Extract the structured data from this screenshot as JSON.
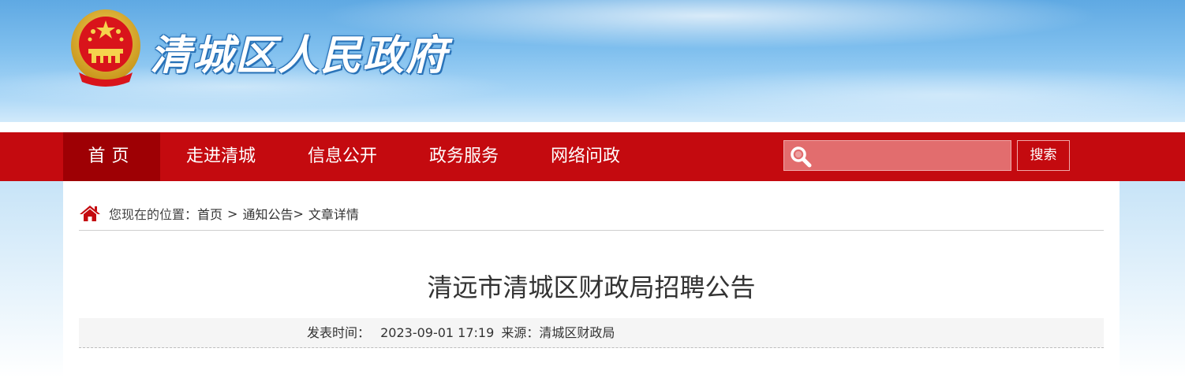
{
  "header": {
    "site_title": "清城区人民政府"
  },
  "nav": {
    "items": [
      {
        "label": "首页",
        "active": true
      },
      {
        "label": "走进清城",
        "active": false
      },
      {
        "label": "信息公开",
        "active": false
      },
      {
        "label": "政务服务",
        "active": false
      },
      {
        "label": "网络问政",
        "active": false
      }
    ],
    "search": {
      "placeholder": "",
      "button_label": "搜索"
    }
  },
  "breadcrumb": {
    "label": "您现在的位置：",
    "items": [
      "首页",
      "通知公告",
      "文章详情"
    ],
    "sep1": ">",
    "sep2": ">"
  },
  "article": {
    "title": "清远市清城区财政局招聘公告",
    "publish_label": "发表时间：",
    "publish_time": "2023-09-01 17:19",
    "source_label": "来源：",
    "source": "清城区财政局"
  },
  "colors": {
    "nav_red": "#c40a0f",
    "nav_active": "#9e0004",
    "search_bg": "#e26d6e"
  },
  "icons": {
    "emblem": "national-emblem-icon",
    "search": "search-icon",
    "home": "home-icon"
  }
}
